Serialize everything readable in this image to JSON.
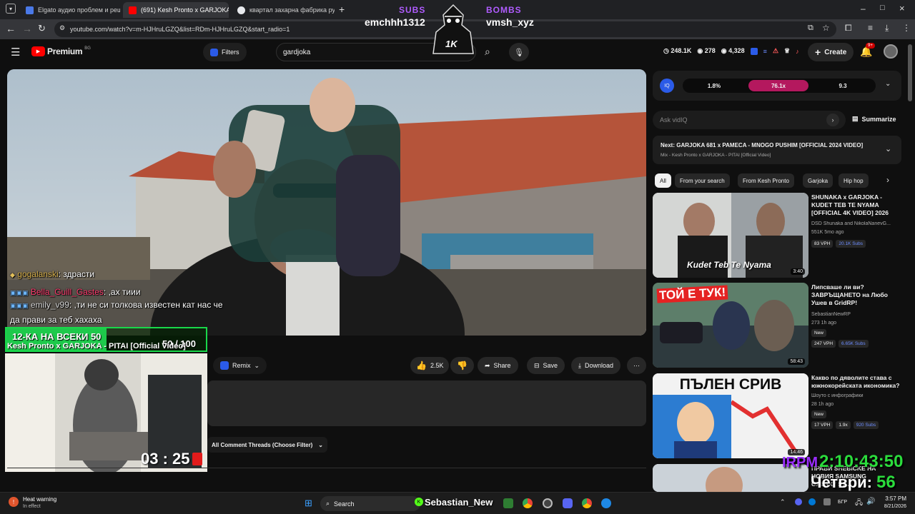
{
  "browser": {
    "tabs": [
      {
        "title": "Elgato аудио проблем и реше",
        "active": false
      },
      {
        "title": "(691) Kesh Pronto x GARJOKA",
        "active": true
      },
      {
        "title": "квартал захарна фабрика русе",
        "active": false
      }
    ],
    "url": "youtube.com/watch?v=m-HJHruLGZQ&list=RDm-HJHruLGZQ&start_radio=1"
  },
  "overlay": {
    "subs_label": "SUBS",
    "bombs_label": "BOMBS",
    "subs_user": "emchhh1312",
    "bombs_user": "vmsh_xyz",
    "mascot_text": "1K",
    "goal_text": "12-КА НА ВСЕКИ 50",
    "goal_count": "50 / 100",
    "timer": "03 : 25",
    "big_time_prefix": "IRPM",
    "big_time": "2:10:43:50",
    "day_text": "Четври:",
    "day_num": "56",
    "streamer_name": "Sebastian_New"
  },
  "chat": [
    {
      "user": "gogalanski",
      "text": ": здрасти"
    },
    {
      "user": "Bella_Guill_Gastes",
      "text": ": ,ах тиии"
    },
    {
      "user": "emily_v99",
      "text": ": ,ти не си толкова известен кат нас че"
    },
    {
      "user": "",
      "text": "да прави за теб хахаха"
    }
  ],
  "youtube": {
    "brand": "Premium",
    "region": "BG",
    "filters_label": "Filters",
    "search_value": "gardjoka",
    "stats": {
      "a": "248.1K",
      "b": "278",
      "c": "4,328"
    },
    "create_label": "Create",
    "notif_count": "9+",
    "video_title": "Kesh Pronto x GARJOKA - PITAI [Official Video]",
    "remix_label": "Remix",
    "like_count": "2.5K",
    "share_label": "Share",
    "save_label": "Save",
    "download_label": "Download",
    "comment_filter": "All Comment Threads (Choose Filter)"
  },
  "vidiq": {
    "stat1": "1.8%",
    "stat2": "76.1x",
    "stat3": "9.3",
    "ask_placeholder": "Ask vidIQ",
    "summarize_label": "Summarize"
  },
  "up_next": {
    "title": "Next: GARJOKA 681 x PAMECA - MNOGO PUSHIM [OFFICIAL 2024 VIDEO]",
    "sub": "Mix - Kesh Pronto x GARJOKA - PITAI [Official Video]"
  },
  "chips": [
    "All",
    "From your search",
    "From Kesh Pronto",
    "Garjoka",
    "Hip hop"
  ],
  "videos": [
    {
      "title": "SHUNAKA x GARJOKA - KUDET TEB TE NYAMA [OFFICIAL 4K VIDEO] 2026",
      "channel": "DSD Shunaka and NikolaNanevG...",
      "meta": "551K  5mo ago",
      "badges": [
        "83 VPH",
        "20.1K Subs"
      ],
      "duration": "3:40",
      "thumb_text": "Kudet Teb Te Nyama"
    },
    {
      "title": "Липсваше ли ви? ЗАВРЪЩАНЕТО на Любо Ушев в GridRP!",
      "channel": "SebastianNewRP",
      "meta": "273  1h ago",
      "badges": [
        "New",
        "247 VPH",
        "6.65K Subs"
      ],
      "duration": "58:43",
      "thumb_text": "ТОЙ Е ТУК!"
    },
    {
      "title": "Какво по дяволите става с южнокорейската икономика?",
      "channel": "Шоуто с инфографики",
      "meta": "28  1h ago",
      "badges": [
        "New",
        "17 VPH",
        "1.9x",
        "920 Subs"
      ],
      "duration": "14:46",
      "thumb_text": "ПЪЛЕН СРИВ"
    },
    {
      "title": "ПРАВИ SHEBICKE НА НОВИЯ SAMSUNG GALAXY S2...",
      "channel": "",
      "meta": "",
      "badges": [],
      "duration": "",
      "thumb_text": ""
    }
  ],
  "taskbar": {
    "weather_title": "Heat warning",
    "weather_sub": "In effect",
    "search_label": "Search",
    "lang": "БГР",
    "time": "3:57 PM",
    "date": "8/21/2026"
  }
}
